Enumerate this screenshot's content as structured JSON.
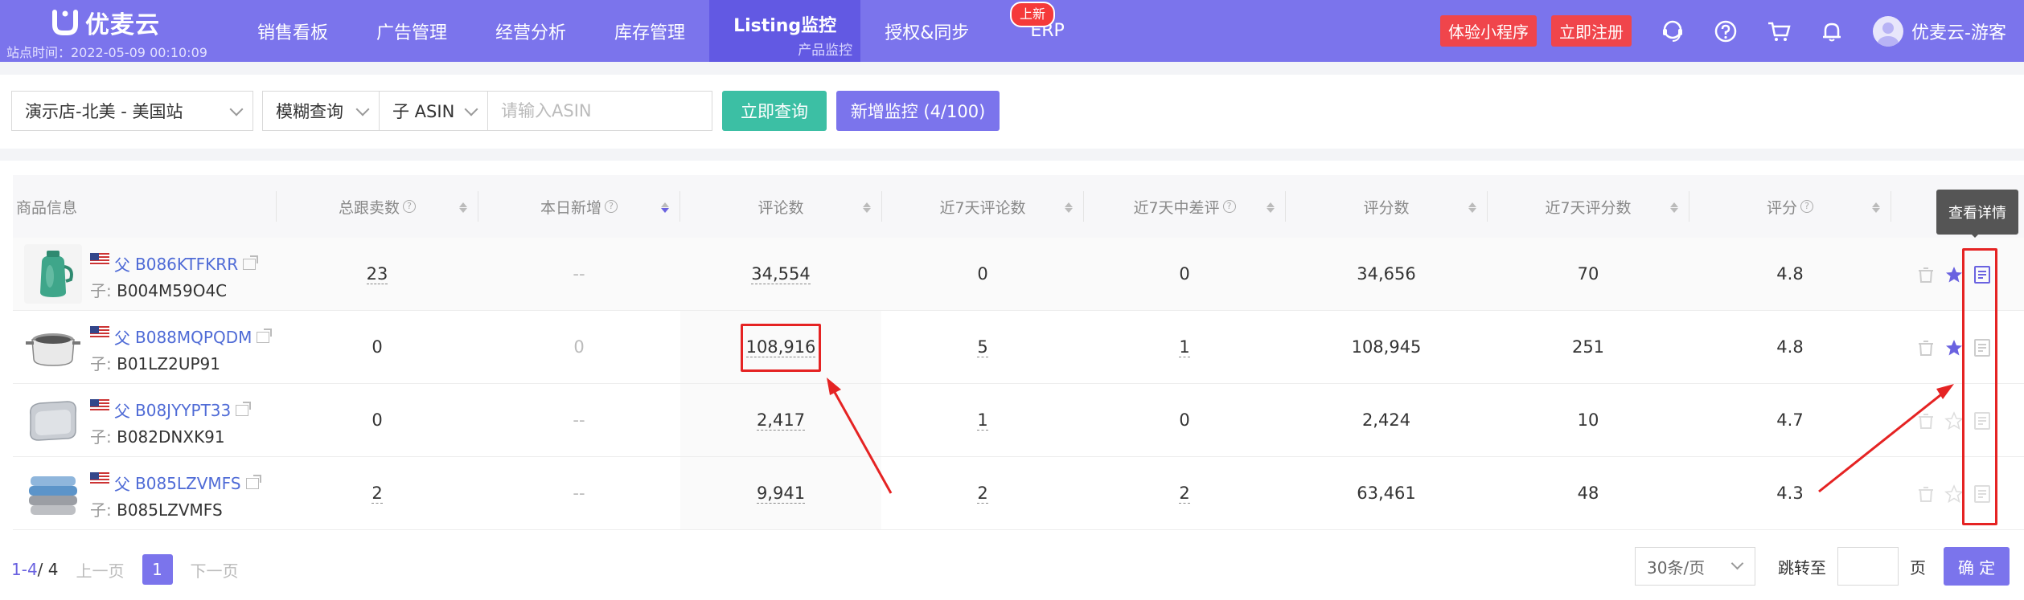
{
  "app": {
    "logo_text": "优麦云",
    "site_time": "站点时间：2022-05-09 00:10:09"
  },
  "nav": {
    "items": [
      {
        "label": "销售看板"
      },
      {
        "label": "广告管理"
      },
      {
        "label": "经营分析"
      },
      {
        "label": "库存管理"
      },
      {
        "label": "Listing监控",
        "sub": "产品监控",
        "active": true
      },
      {
        "label": "授权&同步"
      },
      {
        "label": "ERP"
      }
    ],
    "new_badge": "上新",
    "trial_button": "体验小程序",
    "register_button": "立即注册",
    "user_name": "优麦云-游客",
    "icons": [
      "headset-icon",
      "help-icon",
      "cart-icon",
      "bell-icon",
      "user-avatar-icon"
    ]
  },
  "filters": {
    "store_select": "演示店-北美 - 美国站",
    "query_mode": "模糊查询",
    "asin_type": "子 ASIN",
    "asin_placeholder": "请输入ASIN",
    "query_button": "立即查询",
    "add_monitor_button": "新增监控 (4/100)"
  },
  "table": {
    "columns": [
      {
        "label": "商品信息"
      },
      {
        "label": "总跟卖数",
        "help": "?"
      },
      {
        "label": "本日新增",
        "help": "?"
      },
      {
        "label": "评论数"
      },
      {
        "label": "近7天评论数"
      },
      {
        "label": "近7天中差评",
        "help": "?"
      },
      {
        "label": "评分数"
      },
      {
        "label": "近7天评分数"
      },
      {
        "label": "评分",
        "help": "?"
      }
    ],
    "rows": [
      {
        "parent_prefix": "父",
        "parent": "B086KTFKRR",
        "child_prefix": "子:",
        "child": "B004M59O4C",
        "followers": "23",
        "today_new": "--",
        "reviews": "34,554",
        "reviews_7d": "0",
        "neg_7d": "0",
        "ratings": "34,656",
        "ratings_7d": "70",
        "score": "4.8",
        "starred": true,
        "image": "teapot"
      },
      {
        "parent_prefix": "父",
        "parent": "B088MQPQDM",
        "child_prefix": "子:",
        "child": "B01LZ2UP91",
        "followers": "0",
        "today_new": "0",
        "reviews": "108,916",
        "reviews_7d": "5",
        "neg_7d": "1",
        "ratings": "108,945",
        "ratings_7d": "251",
        "score": "4.8",
        "starred": true,
        "image": "pot"
      },
      {
        "parent_prefix": "父",
        "parent": "B08JYYPT33",
        "child_prefix": "子:",
        "child": "B082DNXK91",
        "followers": "0",
        "today_new": "--",
        "reviews": "2,417",
        "reviews_7d": "1",
        "neg_7d": "0",
        "ratings": "2,424",
        "ratings_7d": "10",
        "score": "4.7",
        "starred": false,
        "image": "pillow"
      },
      {
        "parent_prefix": "父",
        "parent": "B085LZVMFS",
        "child_prefix": "子:",
        "child": "B085LZVMFS",
        "followers": "2",
        "today_new": "--",
        "reviews": "9,941",
        "reviews_7d": "2",
        "neg_7d": "2",
        "ratings": "63,461",
        "ratings_7d": "48",
        "score": "4.3",
        "starred": false,
        "image": "towels"
      }
    ],
    "tooltip": "查看详情"
  },
  "pagination": {
    "range_start": "1-4",
    "range_total": " / 4",
    "prev": "上一页",
    "current": "1",
    "next": "下一页",
    "page_size": "30条/页",
    "jump_label": "跳转至",
    "page_unit": "页",
    "confirm": "确 定"
  },
  "colors": {
    "brand": "#7b74ec",
    "teal": "#3cbfa4",
    "highlight": "#e52323"
  }
}
